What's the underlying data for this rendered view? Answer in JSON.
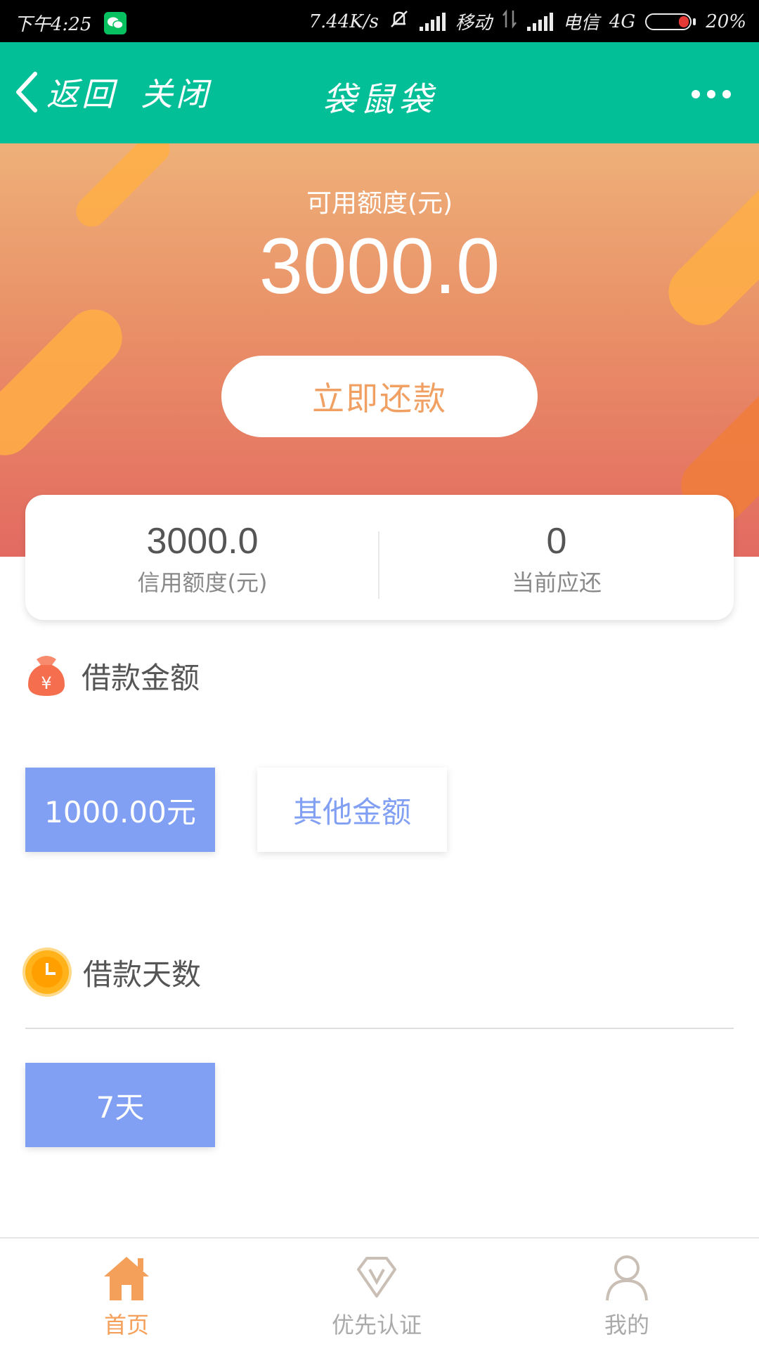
{
  "status_bar": {
    "time": "下午4:25",
    "net_speed": "7.44K/s",
    "carrier1": "移动",
    "carrier2": "电信",
    "network": "4G",
    "battery": "20%",
    "battery_level": 0.2
  },
  "nav": {
    "back": "返回",
    "close": "关闭",
    "title": "袋鼠袋"
  },
  "hero": {
    "label": "可用额度(元)",
    "amount": "3000.0",
    "repay_button": "立即还款"
  },
  "summary": {
    "credit_value": "3000.0",
    "credit_label": "信用额度(元)",
    "due_value": "0",
    "due_label": "当前应还"
  },
  "loan_amount": {
    "title": "借款金额",
    "options": [
      "1000.00元",
      "其他金额"
    ]
  },
  "loan_days": {
    "title": "借款天数",
    "options": [
      "7天"
    ]
  },
  "tabs": [
    {
      "label": "首页",
      "icon": "home-icon",
      "active": true
    },
    {
      "label": "优先认证",
      "icon": "verify-badge-icon",
      "active": false
    },
    {
      "label": "我的",
      "icon": "user-icon",
      "active": false
    }
  ],
  "colors": {
    "nav_bg": "#03bf98",
    "accent_orange": "#f5a05a",
    "option_blue": "#82a0f3"
  }
}
